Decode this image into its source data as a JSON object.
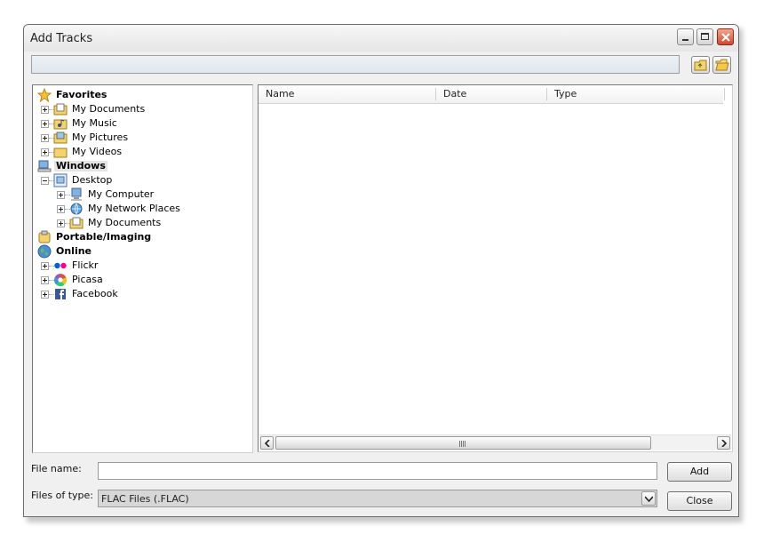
{
  "window": {
    "title": "Add Tracks"
  },
  "path": {
    "value": ""
  },
  "tree": {
    "favorites": "Favorites",
    "my_documents": "My Documents",
    "my_music": "My Music",
    "my_pictures": "My Pictures",
    "my_videos": "My Videos",
    "windows": "Windows",
    "desktop": "Desktop",
    "my_computer": "My Computer",
    "my_network_places": "My Network Places",
    "desktop_my_documents": "My Documents",
    "portable": "Portable/Imaging",
    "online": "Online",
    "flickr": "Flickr",
    "picasa": "Picasa",
    "facebook": "Facebook"
  },
  "list": {
    "columns": [
      "Name",
      "Date",
      "Type"
    ]
  },
  "form": {
    "file_name_label": "File name:",
    "file_name_value": "",
    "file_type_label": "Files of type:",
    "file_type_value": "FLAC Files (.FLAC)"
  },
  "buttons": {
    "add": "Add",
    "close": "Close"
  },
  "colors": {
    "close_button": "#d3452c",
    "selected_background": "#e4e4e4",
    "type_select_background": "#d7d7d7"
  }
}
